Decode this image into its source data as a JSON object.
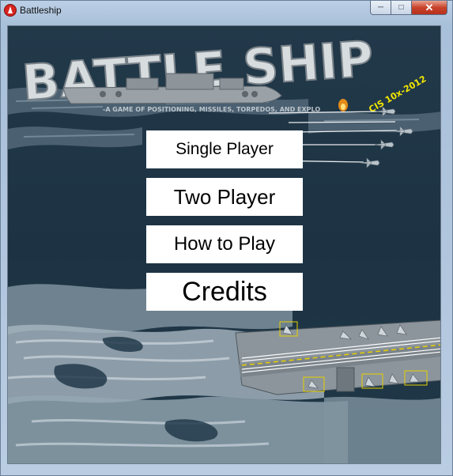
{
  "window": {
    "title": "Battleship",
    "controls": {
      "minimize_icon": "minimize-icon",
      "maximize_icon": "maximize-icon",
      "close_icon": "close-icon"
    }
  },
  "splash": {
    "logo_title": "BATTLE SHIP",
    "logo_subtitle": "-A GAME OF POSITIONING, MISSILES, TORPEDOS, AND EXPLO",
    "course_tag": "CIS 10x-2012"
  },
  "menu": {
    "single_player": "Single Player",
    "two_player": "Two Player",
    "how_to_play": "How to Play",
    "credits": "Credits"
  },
  "colors": {
    "ocean": "#1f3444",
    "foam": "#cfd8de",
    "button_bg": "#ffffff",
    "tag_yellow": "#f2e600"
  }
}
